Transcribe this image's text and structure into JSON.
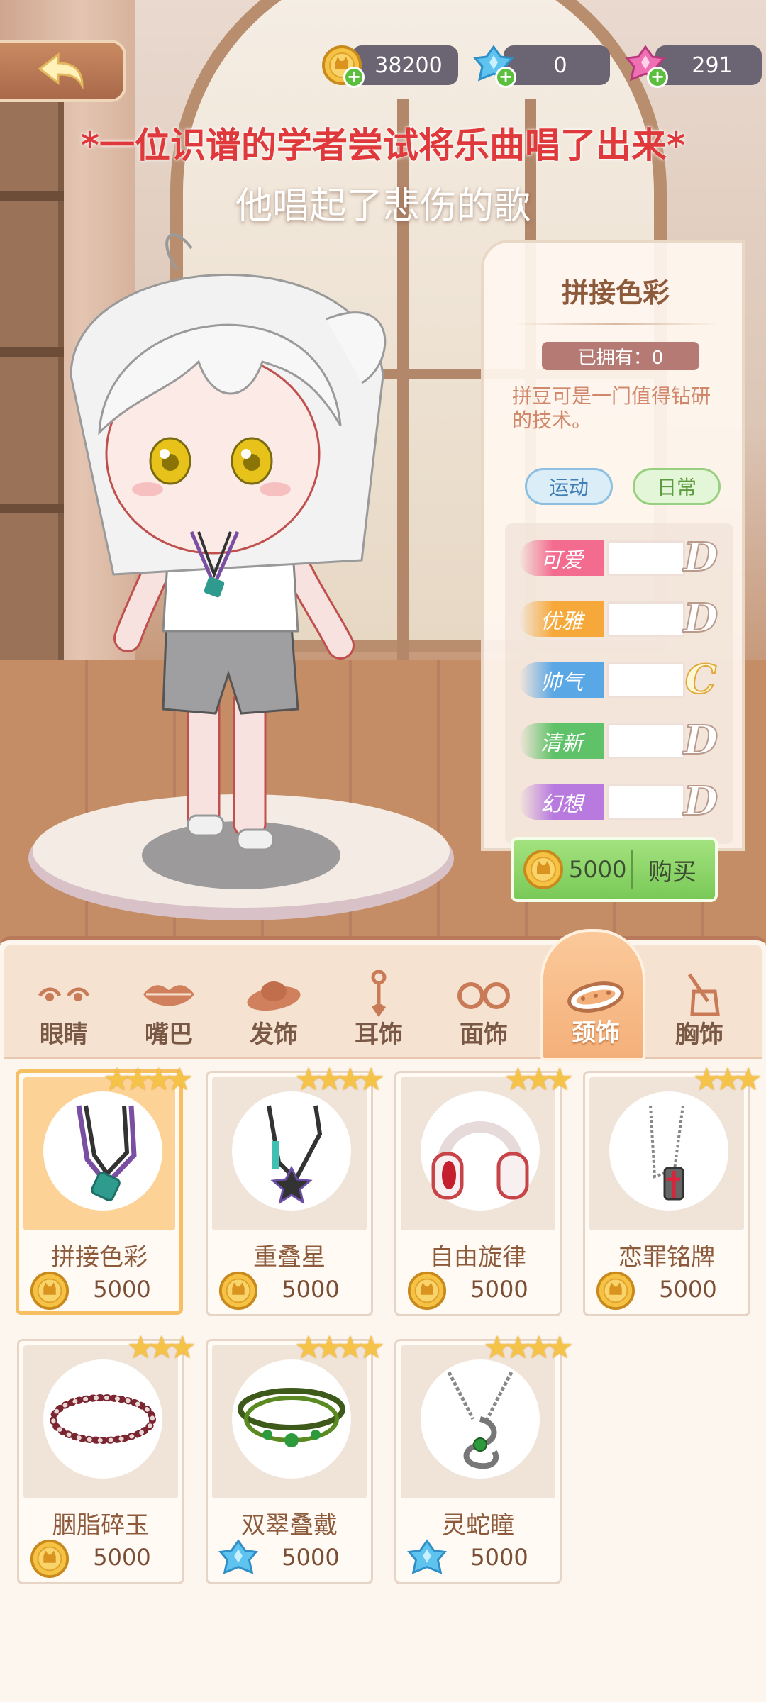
{
  "header": {
    "currencies": [
      {
        "name": "gold-coin",
        "value": "38200",
        "color": "#f2b134"
      },
      {
        "name": "blue-diamond",
        "value": "0",
        "color": "#56b8e8"
      },
      {
        "name": "pink-diamond",
        "value": "291",
        "color": "#e55da8"
      }
    ]
  },
  "story": {
    "line1": "*一位识谱的学者尝试将乐曲唱了出来*",
    "line2": "他唱起了悲伤的歌"
  },
  "item_detail": {
    "title": "拼接色彩",
    "owned": "已拥有：0",
    "description": "拼豆可是一门值得钻研的技术。",
    "tags": [
      "运动",
      "日常"
    ],
    "attributes": [
      {
        "label": "可爱",
        "grade": "D",
        "color": "#f36b8f"
      },
      {
        "label": "优雅",
        "grade": "D",
        "color": "#f6a93a"
      },
      {
        "label": "帅气",
        "grade": "C",
        "color": "#5aa7e6"
      },
      {
        "label": "清新",
        "grade": "D",
        "color": "#5fc268"
      },
      {
        "label": "幻想",
        "grade": "D",
        "color": "#b97ae0"
      }
    ],
    "buy": {
      "price": "5000",
      "label": "购买"
    }
  },
  "categories": [
    {
      "label": "眼睛",
      "icon": "eye-icon",
      "active": false
    },
    {
      "label": "嘴巴",
      "icon": "lips-icon",
      "active": false
    },
    {
      "label": "发饰",
      "icon": "hat-icon",
      "active": false
    },
    {
      "label": "耳饰",
      "icon": "earring-icon",
      "active": false
    },
    {
      "label": "面饰",
      "icon": "glasses-icon",
      "active": false
    },
    {
      "label": "颈饰",
      "icon": "collar-icon",
      "active": true
    },
    {
      "label": "胸饰",
      "icon": "bag-icon",
      "active": false
    }
  ],
  "items": [
    {
      "name": "拼接色彩",
      "price": "5000",
      "currency": "gold-coin",
      "stars": 4,
      "selected": true
    },
    {
      "name": "重叠星",
      "price": "5000",
      "currency": "gold-coin",
      "stars": 4,
      "selected": false
    },
    {
      "name": "自由旋律",
      "price": "5000",
      "currency": "gold-coin",
      "stars": 3,
      "selected": false
    },
    {
      "name": "恋罪铭牌",
      "price": "5000",
      "currency": "gold-coin",
      "stars": 3,
      "selected": false
    },
    {
      "name": "胭脂碎玉",
      "price": "5000",
      "currency": "gold-coin",
      "stars": 3,
      "selected": false
    },
    {
      "name": "双翠叠戴",
      "price": "5000",
      "currency": "blue-diamond",
      "stars": 4,
      "selected": false
    },
    {
      "name": "灵蛇瞳",
      "price": "5000",
      "currency": "blue-diamond",
      "stars": 4,
      "selected": false
    }
  ]
}
